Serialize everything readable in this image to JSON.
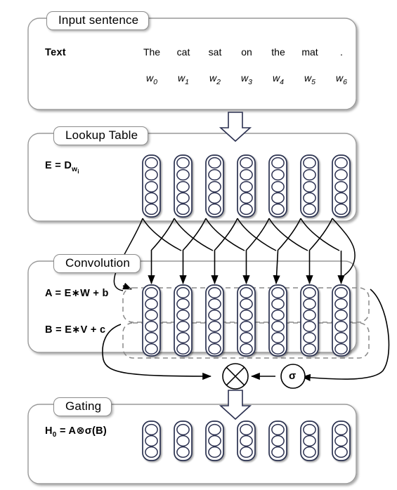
{
  "diagram": {
    "title_internal": "Gated Convolutional Network Layer",
    "sections": [
      {
        "id": "input",
        "title": "Input sentence",
        "label": "Text"
      },
      {
        "id": "lookup",
        "title": "Lookup Table",
        "label": "E = D"
      },
      {
        "id": "convolution",
        "title": "Convolution",
        "label_a": "A = E∗W + b",
        "label_b": "B = E∗V + c"
      },
      {
        "id": "gating",
        "title": "Gating",
        "label": "H"
      }
    ],
    "sentence": {
      "tokens": [
        "The",
        "cat",
        "sat",
        "on",
        "the",
        "mat",
        "."
      ],
      "symbols": [
        "w",
        "w",
        "w",
        "w",
        "w",
        "w",
        "w"
      ],
      "indices": [
        "0",
        "1",
        "2",
        "3",
        "4",
        "5",
        "6"
      ]
    },
    "lookup": {
      "formula_base": "E = D",
      "formula_sub": "w",
      "formula_subsub": "i",
      "columns": 7,
      "cells_per_column": 5
    },
    "convolution": {
      "formula_a": "A = E∗W + b",
      "formula_b": "B = E∗V + c",
      "columns": 7,
      "cells_per_column": 6,
      "region_a_cells": 3,
      "region_b_cells": 3,
      "region_a_name": "A",
      "region_b_name": "B"
    },
    "gating": {
      "formula_base": "H",
      "formula_sub": "0",
      "formula_rest": " = A⊗σ(B)",
      "columns": 7,
      "cells_per_column": 3
    },
    "nodes": {
      "product_symbol": "⊗",
      "sigma_symbol": "σ"
    },
    "colors": {
      "stroke": "#2b3050",
      "box_border": "#9a9a9a",
      "dashed": "#8a8a8a",
      "arrow": "#000000",
      "background": "#ffffff"
    }
  }
}
